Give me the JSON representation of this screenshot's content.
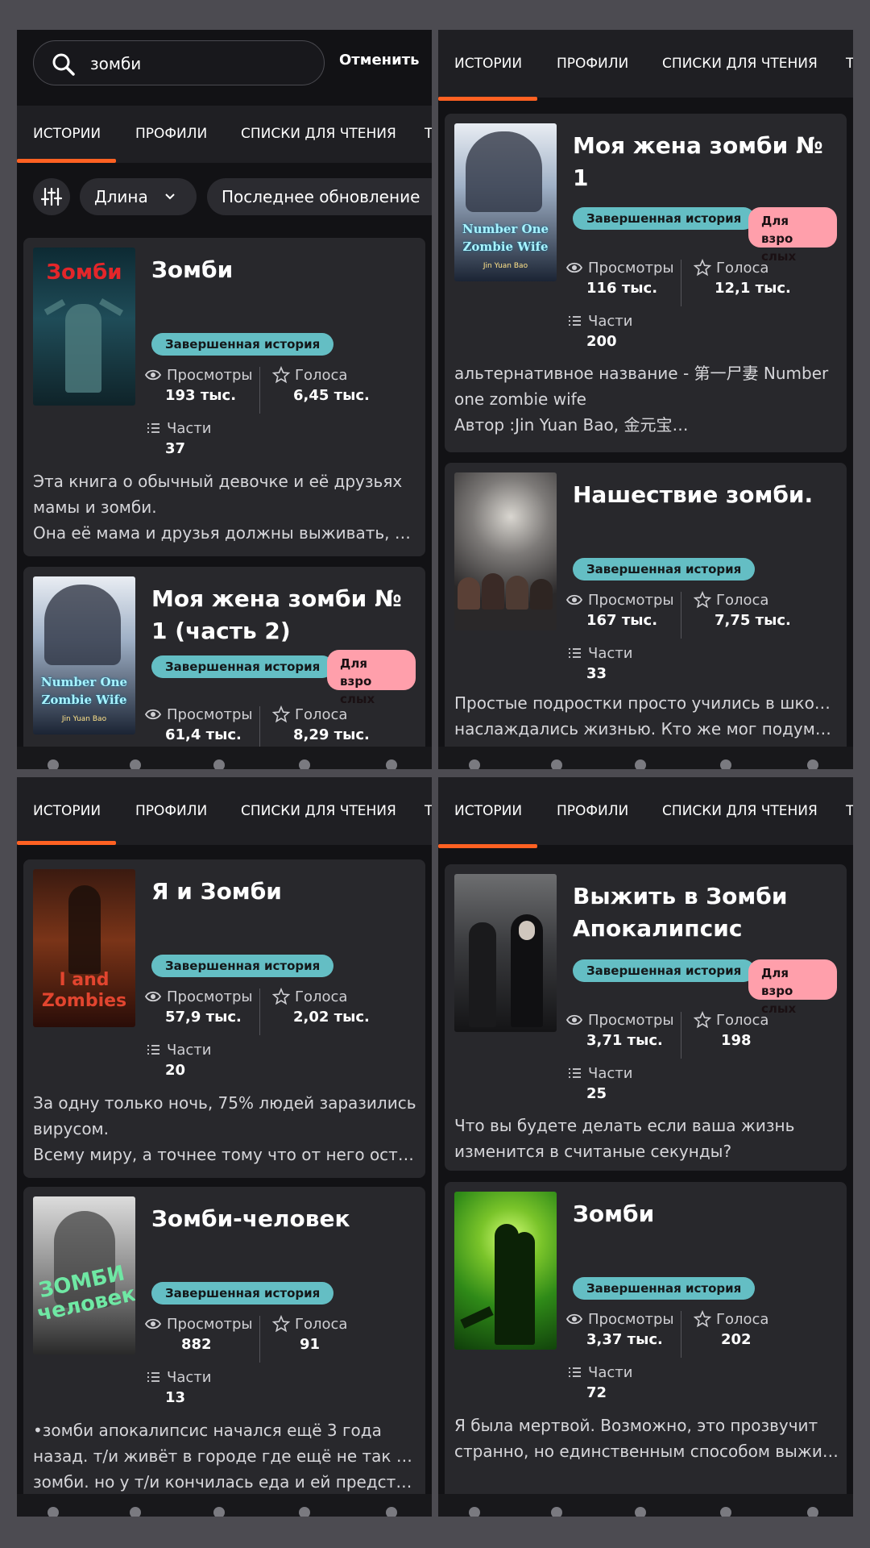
{
  "search": {
    "query": "зомби",
    "cancel": "Отменить"
  },
  "tabs": [
    "ИСТОРИИ",
    "ПРОФИЛИ",
    "СПИСКИ ДЛЯ ЧТЕНИЯ",
    "Т"
  ],
  "filters": {
    "length": "Длина",
    "updated": "Последнее обновление"
  },
  "labels": {
    "views": "Просмотры",
    "votes": "Голоса",
    "parts": "Части",
    "completed": "Завершенная история",
    "mature": "Для взро слых"
  },
  "colors": {
    "accent": "#ff6122",
    "badge": "#64bec4",
    "mature": "#ff9fab"
  },
  "panels": [
    {
      "stories": [
        {
          "title": "Зомби",
          "views": "193 тыс.",
          "votes": "6,45 тыс.",
          "parts": "37",
          "mature": false,
          "desc": [
            "Эта книга о обычный девочке и её друзьях",
            "мамы и зомби.",
            "Она её мама и друзья должны выживать, в г…"
          ]
        },
        {
          "title": "Моя жена зомби № 1 (часть 2)",
          "views": "61,4 тыс.",
          "votes": "8,29 тыс.",
          "parts": "",
          "mature": true,
          "desc": []
        }
      ]
    },
    {
      "stories": [
        {
          "title": "Моя жена зомби № 1",
          "views": "116 тыс.",
          "votes": "12,1 тыс.",
          "parts": "200",
          "mature": true,
          "desc": [
            "альтернативное название - 第一尸妻 Number",
            "one zombie wife",
            "Автор :Jin Yuan Bao,  金元宝…"
          ]
        },
        {
          "title": "Нашествие зомби.",
          "views": "167 тыс.",
          "votes": "7,75 тыс.",
          "parts": "33",
          "mature": false,
          "desc": [
            "Простые подростки просто учились в школе и",
            "наслаждались жизнью. Кто же мог подумать,"
          ]
        }
      ]
    },
    {
      "stories": [
        {
          "title": "Я и Зомби",
          "views": "57,9 тыс.",
          "votes": "2,02 тыс.",
          "parts": "20",
          "mature": false,
          "desc": [
            "За одну только ночь, 75% людей заразились",
            "вирусом.",
            "Всему миру, а точнее тому что от него остал…"
          ]
        },
        {
          "title": "Зомби-человек",
          "views": "882",
          "votes": "91",
          "parts": "13",
          "mature": false,
          "desc": [
            "•зомби апокалипсис начался ещё 3 года",
            "назад. т/и живёт в городе где ещё не так много",
            "зомби. но у т/и кончилась еда и ей предстои…"
          ]
        }
      ]
    },
    {
      "stories": [
        {
          "title": "Выжить в Зомби Апокалипсис",
          "views": "3,71 тыс.",
          "votes": "198",
          "parts": "25",
          "mature": true,
          "desc": [
            "Что вы будете делать если ваша жизнь",
            "изменится в считаные секунды?"
          ]
        },
        {
          "title": "Зомби",
          "views": "3,37 тыс.",
          "votes": "202",
          "parts": "72",
          "mature": false,
          "desc": [
            "Я была мертвой. Возможно, это прозвучит",
            "странно, но единственным способом выжить"
          ]
        }
      ]
    }
  ],
  "covers": [
    {
      "text": "Зомби"
    },
    {
      "text": "Number One Zombie Wife",
      "author": "Jin Yuan Bao"
    },
    {
      "text": "Number One Zombie Wife",
      "author": "Jin Yuan Bao"
    },
    {
      "text": ""
    },
    {
      "text": "I and Zombies"
    },
    {
      "text": "ЗОМБИ человек"
    },
    {
      "text": ""
    },
    {
      "text": ""
    }
  ]
}
